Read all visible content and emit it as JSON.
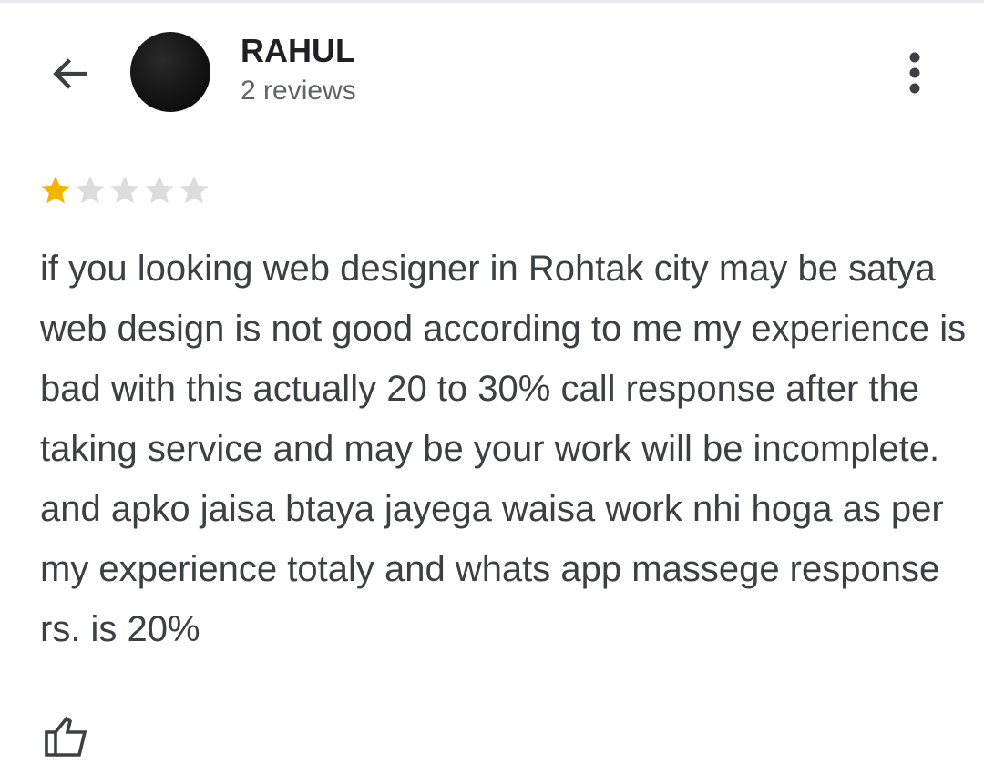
{
  "reviewer": {
    "name": "RAHUL",
    "review_count": "2 reviews"
  },
  "review": {
    "rating": 1,
    "max_rating": 5,
    "text": "if you looking web designer in Rohtak city may be satya web design is not good according to me my experience is bad with this actually 20 to 30% call response after the taking service and may be your work will be incomplete. and apko jaisa btaya jayega waisa work nhi hoga as per my experience totaly and whats app massege response rs. is 20%"
  },
  "icons": {
    "back": "arrow-left-icon",
    "more": "more-vertical-icon",
    "like": "thumbs-up-icon",
    "star": "star-icon"
  },
  "colors": {
    "star_filled": "#f4b400",
    "star_empty": "#dadce0",
    "name": "#202124",
    "secondary_text": "#5f6368",
    "body_text": "#3c4043"
  }
}
